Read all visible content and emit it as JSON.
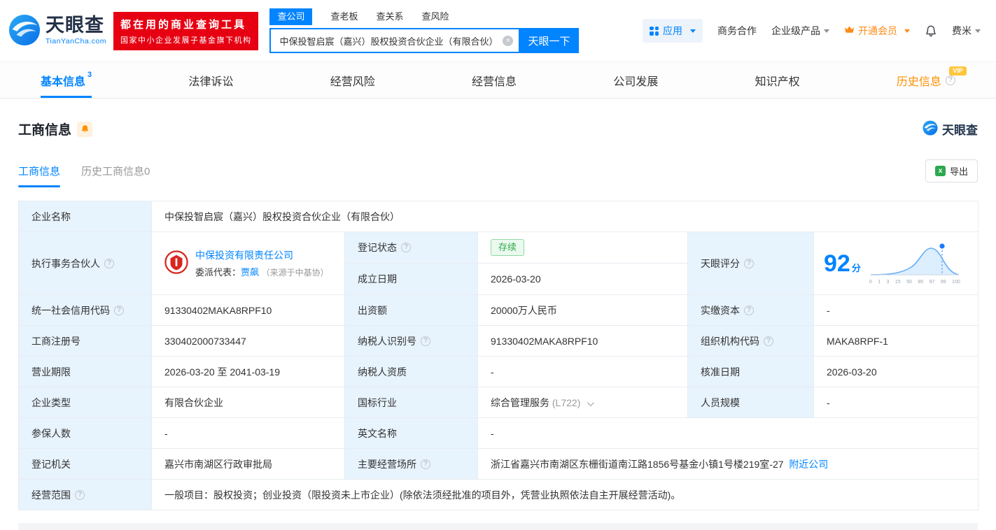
{
  "colors": {
    "accent": "#0084ff",
    "vip_orange": "#ff8b17",
    "badge_red": "#e60012",
    "status_green": "#2fa84f"
  },
  "header": {
    "logo": {
      "cn": "天眼查",
      "en": "TianYanCha.com"
    },
    "badge": {
      "line1": "都在用的商业查询工具",
      "line2": "国家中小企业发展子基金旗下机构"
    },
    "search": {
      "tabs": [
        {
          "label": "查公司",
          "active": true
        },
        {
          "label": "查老板",
          "active": false
        },
        {
          "label": "查关系",
          "active": false
        },
        {
          "label": "查风险",
          "active": false
        }
      ],
      "value": "中保投智启宸（嘉兴）股权投资合伙企业（有限合伙）",
      "button": "天眼一下"
    },
    "menu": {
      "apps": "应用",
      "cooperation": "商务合作",
      "enterprise": "企业级产品",
      "vip": "开通会员",
      "user": "费米"
    }
  },
  "nav": {
    "tabs": [
      {
        "label": "基本信息",
        "badge": "3",
        "active": true
      },
      {
        "label": "法律诉讼"
      },
      {
        "label": "经营风险"
      },
      {
        "label": "经营信息"
      },
      {
        "label": "公司发展"
      },
      {
        "label": "知识产权"
      },
      {
        "label": "历史信息",
        "vip_tag": "VIP"
      }
    ]
  },
  "section": {
    "title": "工商信息",
    "watermark": "天眼查",
    "subtabs": [
      {
        "label": "工商信息",
        "active": true
      },
      {
        "label": "历史工商信息0",
        "active": false
      }
    ],
    "export_label": "导出"
  },
  "info": {
    "ent_name": {
      "label": "企业名称",
      "value": "中保投智启宸（嘉兴）股权投资合伙企业（有限合伙）"
    },
    "partner": {
      "label": "执行事务合伙人",
      "company": "中保投资有限责任公司",
      "rep_label": "委派代表：",
      "rep": "贾飙",
      "source": "（来源于中基协）"
    },
    "reg_status": {
      "label": "登记状态",
      "value": "存续"
    },
    "est_date": {
      "label": "成立日期",
      "value": "2026-03-20"
    },
    "score": {
      "label": "天眼评分",
      "value": "92",
      "unit": "分",
      "axis": [
        "0",
        "1",
        "3",
        "15",
        "50",
        "85",
        "97",
        "99",
        "100"
      ]
    },
    "credit_code": {
      "label": "统一社会信用代码",
      "value": "91330402MAKA8RPF10"
    },
    "capital": {
      "label": "出资额",
      "value": "20000万人民币"
    },
    "paid_capital": {
      "label": "实缴资本",
      "value": "-"
    },
    "reg_no": {
      "label": "工商注册号",
      "value": "330402000733447"
    },
    "tax_id": {
      "label": "纳税人识别号",
      "value": "91330402MAKA8RPF10"
    },
    "org_code": {
      "label": "组织机构代码",
      "value": "MAKA8RPF-1"
    },
    "term": {
      "label": "营业期限",
      "value": "2026-03-20 至 2041-03-19"
    },
    "tax_qual": {
      "label": "纳税人资质",
      "value": "-"
    },
    "approve_date": {
      "label": "核准日期",
      "value": "2026-03-20"
    },
    "ent_type": {
      "label": "企业类型",
      "value": "有限合伙企业"
    },
    "industry": {
      "label": "国标行业",
      "value": "综合管理服务",
      "code": "(L722)"
    },
    "staff": {
      "label": "人员规模",
      "value": "-"
    },
    "insured": {
      "label": "参保人数",
      "value": "-"
    },
    "en_name": {
      "label": "英文名称",
      "value": "-"
    },
    "authority": {
      "label": "登记机关",
      "value": "嘉兴市南湖区行政审批局"
    },
    "address": {
      "label": "主要经营场所",
      "value": "浙江省嘉兴市南湖区东栅街道南江路1856号基金小镇1号楼219室-27",
      "nearby": "附近公司"
    },
    "scope": {
      "label": "经营范围",
      "value": "一般项目：股权投资；创业投资（限投资未上市企业）(除依法须经批准的项目外，凭营业执照依法自主开展经营活动)。"
    }
  }
}
